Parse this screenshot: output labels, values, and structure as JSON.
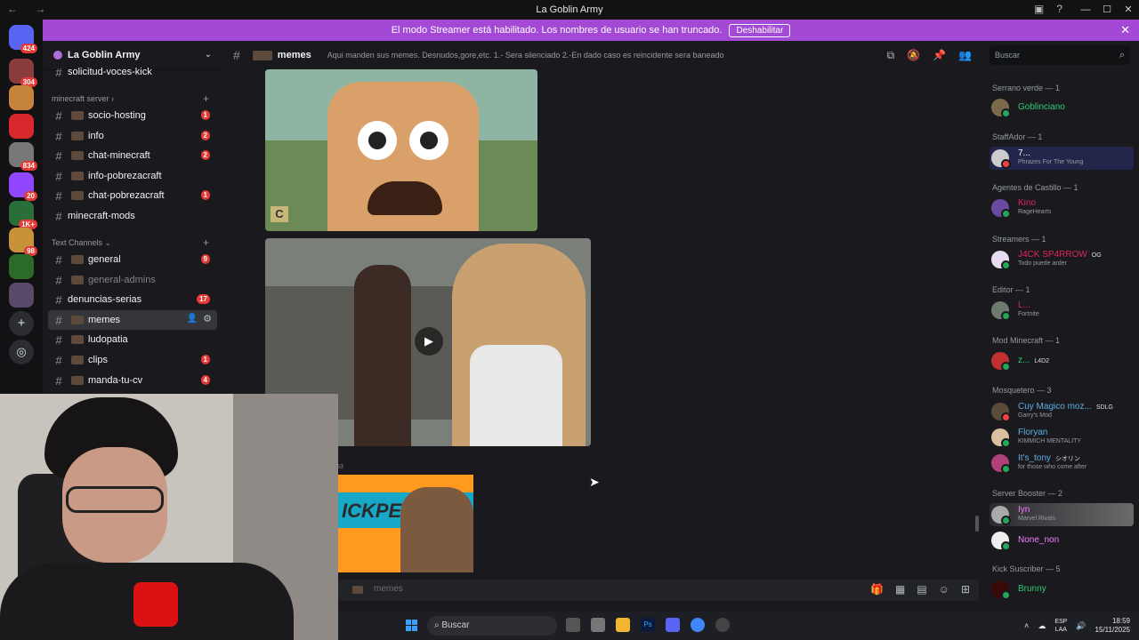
{
  "window": {
    "title": "La Goblin Army"
  },
  "banner": {
    "text": "El modo Streamer está habilitado. Los nombres de usuario se han truncado.",
    "button": "Deshabilitar"
  },
  "server_badges": [
    "424",
    "304",
    "834",
    "20",
    "1K+",
    "98"
  ],
  "guild": {
    "name": "La Goblin Army"
  },
  "channels": {
    "top_item": "solicitud-voces-kick",
    "cat_minecraft": "minecraft server",
    "cat_text": "Text Channels",
    "items": [
      {
        "label": "socio-hosting",
        "badge": "1"
      },
      {
        "label": "info",
        "badge": "2"
      },
      {
        "label": "chat-minecraft",
        "badge": "2"
      },
      {
        "label": "info-pobrezacraft",
        "badge": ""
      },
      {
        "label": "chat-pobrezacraft",
        "badge": "1"
      },
      {
        "label": "minecraft-mods",
        "badge": ""
      },
      {
        "label": "general",
        "badge": "9"
      },
      {
        "label": "general-admins",
        "badge": ""
      },
      {
        "label": "denuncias-serias",
        "badge": "17"
      },
      {
        "label": "memes",
        "badge": ""
      },
      {
        "label": "ludopatia",
        "badge": ""
      },
      {
        "label": "clips",
        "badge": "1"
      },
      {
        "label": "manda-tu-cv",
        "badge": "4"
      }
    ]
  },
  "header": {
    "channel": "memes",
    "topic": "Aqui manden sus memes. Desnudos,gore,etc. 1.- Sera silenciado 2.-En dado caso es reincidente sera baneado",
    "search_placeholder": "Buscar"
  },
  "chat": {
    "stamp": "53",
    "composer_placeholder": "memes",
    "thumb_text": "ICKPERU"
  },
  "members": {
    "groups": [
      {
        "header": "Serrano verde — 1",
        "members": [
          {
            "name": "Goblinciano",
            "activity": "",
            "tag": "",
            "color": "#2ecc71"
          }
        ]
      },
      {
        "header": "StaffAdor — 1",
        "members": [
          {
            "name": "7...",
            "activity": "Phrazes For The Young",
            "tag": "",
            "color": "#ffffff"
          }
        ]
      },
      {
        "header": "Agentes de Castillo — 1",
        "members": [
          {
            "name": "Kino",
            "activity": "RageHearts",
            "tag": "",
            "color": "#e0245e"
          }
        ]
      },
      {
        "header": "Streamers — 1",
        "members": [
          {
            "name": "J4CK SP4RROW",
            "activity": "Todo puede arder",
            "tag": "OG",
            "color": "#e0245e"
          }
        ]
      },
      {
        "header": "Editor — 1",
        "members": [
          {
            "name": "L...",
            "activity": "Fortnite",
            "tag": "",
            "color": "#e0245e"
          }
        ]
      },
      {
        "header": "Mod Minecraft — 1",
        "members": [
          {
            "name": "z...",
            "activity": "",
            "tag": "L4D2",
            "color": "#2ecc71"
          }
        ]
      },
      {
        "header": "Mosquetero — 3",
        "members": [
          {
            "name": "Cuy Magico moz...",
            "activity": "Garry's Mod",
            "tag": "SDLG",
            "color": "#5dade2"
          },
          {
            "name": "Floryan",
            "activity": "KIMMICH MENTALITY",
            "tag": "",
            "color": "#5dade2"
          },
          {
            "name": "It's_tony",
            "activity": "for those who come after",
            "tag": "シオリン",
            "color": "#5dade2"
          }
        ]
      },
      {
        "header": "Server Booster — 2",
        "members": [
          {
            "name": "Iyn",
            "activity": "Marvel Rivals",
            "tag": "",
            "color": "#f47fff"
          },
          {
            "name": "None_non",
            "activity": "",
            "tag": "",
            "color": "#f47fff"
          }
        ]
      },
      {
        "header": "Kick Suscriber — 5",
        "members": [
          {
            "name": "Brunny",
            "activity": "",
            "tag": "",
            "color": "#2ecc71"
          }
        ]
      }
    ]
  },
  "taskbar": {
    "search": "Buscar",
    "lang1": "ESP",
    "lang2": "LAA",
    "time": "18:59",
    "date": "15/11/2025"
  }
}
